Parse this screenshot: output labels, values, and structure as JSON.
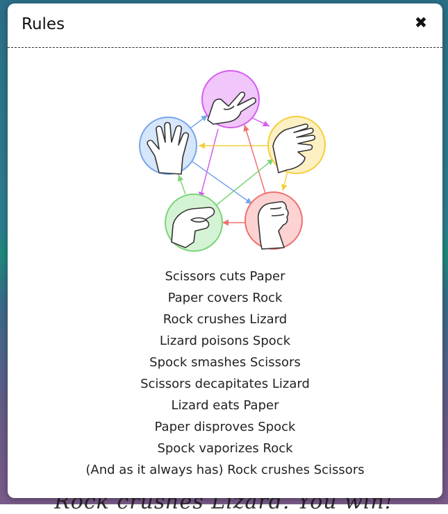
{
  "modal": {
    "title": "Rules",
    "close_icon": "close-icon"
  },
  "diagram": {
    "gestures": [
      {
        "name": "scissors",
        "icon": "scissors-hand-icon",
        "color": "#d45cf0",
        "fill": "#f1c6fb"
      },
      {
        "name": "paper",
        "icon": "paper-hand-icon",
        "color": "#f2cf3c",
        "fill": "#fdf0c2"
      },
      {
        "name": "rock",
        "icon": "rock-hand-icon",
        "color": "#f07070",
        "fill": "#fcd2d2"
      },
      {
        "name": "lizard",
        "icon": "lizard-hand-icon",
        "color": "#7ad47a",
        "fill": "#d4f3d4"
      },
      {
        "name": "spock",
        "icon": "spock-hand-icon",
        "color": "#76a6ea",
        "fill": "#d6e6fb"
      }
    ]
  },
  "rules": [
    "Scissors cuts Paper",
    "Paper covers Rock",
    "Rock crushes Lizard",
    "Lizard poisons Spock",
    "Spock smashes Scissors",
    "Scissors decapitates Lizard",
    "Lizard eats Paper",
    "Paper disproves Spock",
    "Spock vaporizes Rock",
    "(And as it always has) Rock crushes Scissors"
  ],
  "background": {
    "footer_text": "Rock crushes Lizard. You win!"
  }
}
